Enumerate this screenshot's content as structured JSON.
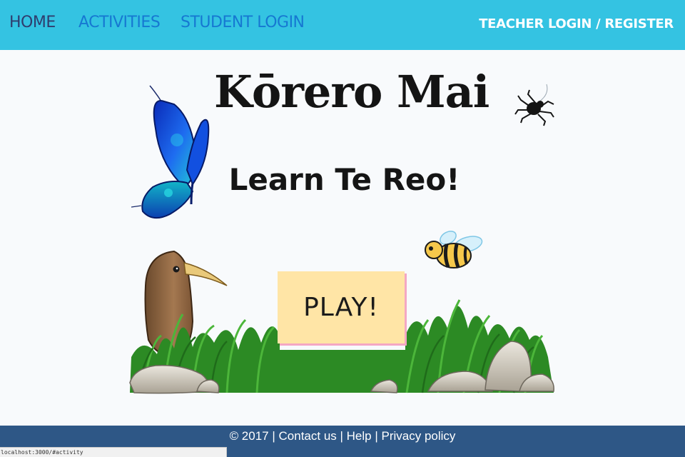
{
  "nav": {
    "home": "HOME",
    "activities": "ACTIVITIES",
    "student_login": "STUDENT LOGIN",
    "teacher_login": "TEACHER LOGIN / REGISTER"
  },
  "hero": {
    "title": "Kōrero Mai",
    "subtitle": "Learn Te Reo!",
    "play_label": "PLAY!"
  },
  "footer": {
    "copyright": "© 2017",
    "separator": " | ",
    "contact": "Contact us",
    "help": "Help",
    "privacy": "Privacy policy"
  },
  "status_bar": {
    "url": "localhost:3000/#activity"
  },
  "icons": [
    "butterfly-icon",
    "spider-icon",
    "bee-icon",
    "kiwi-bird-icon",
    "grass-icon",
    "rocks-icon"
  ],
  "colors": {
    "nav_bg": "#34c3e2",
    "nav_active": "#2f3d6e",
    "nav_link": "#1678d2",
    "play_bg": "#ffe5a6",
    "play_shadow": "#f4a7c4",
    "footer_bg": "#2e5786"
  }
}
